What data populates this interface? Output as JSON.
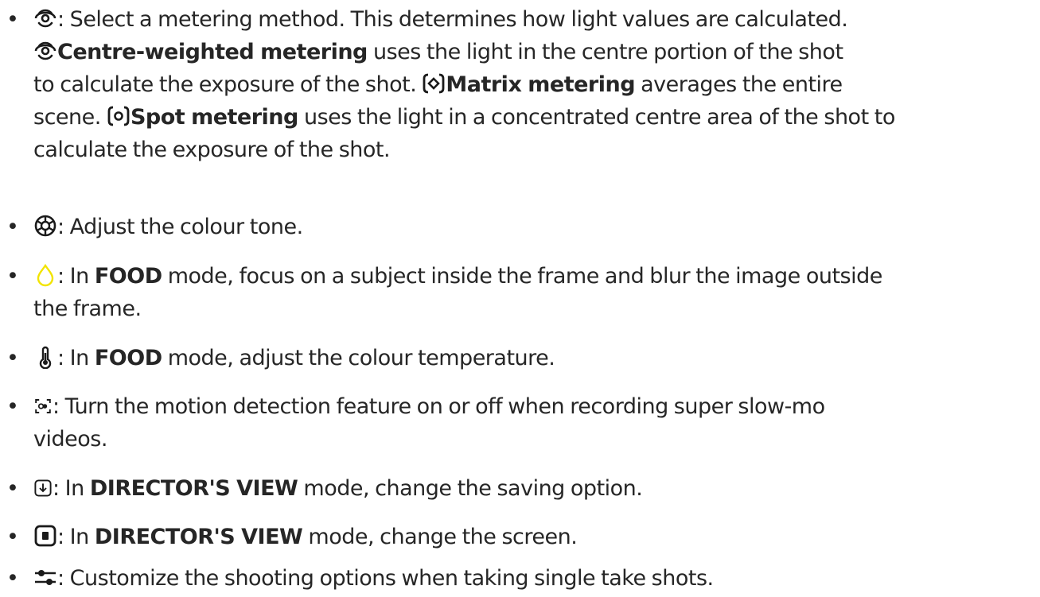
{
  "bullet": "•",
  "items": [
    {
      "icon": "centre-weighted-metering-icon",
      "lines": [
        ": Select a metering method. This determines how light values are calculated.",
        "",
        "to calculate the exposure of the shot.",
        "scene.",
        "calculate the exposure of the shot."
      ],
      "centre_label": "Centre-weighted metering",
      "centre_desc": "uses the light in the centre portion of the shot",
      "matrix_label": "Matrix metering",
      "matrix_desc": "averages the entire",
      "spot_label": "Spot metering",
      "spot_desc": "uses the light in a concentrated centre area of the shot to"
    },
    {
      "icon": "colour-tone-icon",
      "text": ": Adjust the colour tone."
    },
    {
      "icon": "drop-focus-icon",
      "icon_color": "#f2e400",
      "prefix": ": In",
      "mode": "FOOD",
      "rest": "mode, focus on a subject inside the frame and blur the image outside",
      "line2": "the frame."
    },
    {
      "icon": "thermometer-icon",
      "prefix": ": In",
      "mode": "FOOD",
      "rest": "mode, adjust the colour temperature."
    },
    {
      "icon": "motion-detection-icon",
      "text": ": Turn the motion detection feature on or off when recording super slow-mo",
      "line2": "videos."
    },
    {
      "icon": "saving-option-icon",
      "prefix": ": In",
      "mode": "DIRECTOR'S VIEW",
      "rest": "mode, change the saving option."
    },
    {
      "icon": "screen-icon",
      "prefix": ": In",
      "mode": "DIRECTOR'S VIEW",
      "rest": "mode, change the screen."
    },
    {
      "icon": "shooting-options-icon",
      "text": ": Customize the shooting options when taking single take shots."
    }
  ]
}
